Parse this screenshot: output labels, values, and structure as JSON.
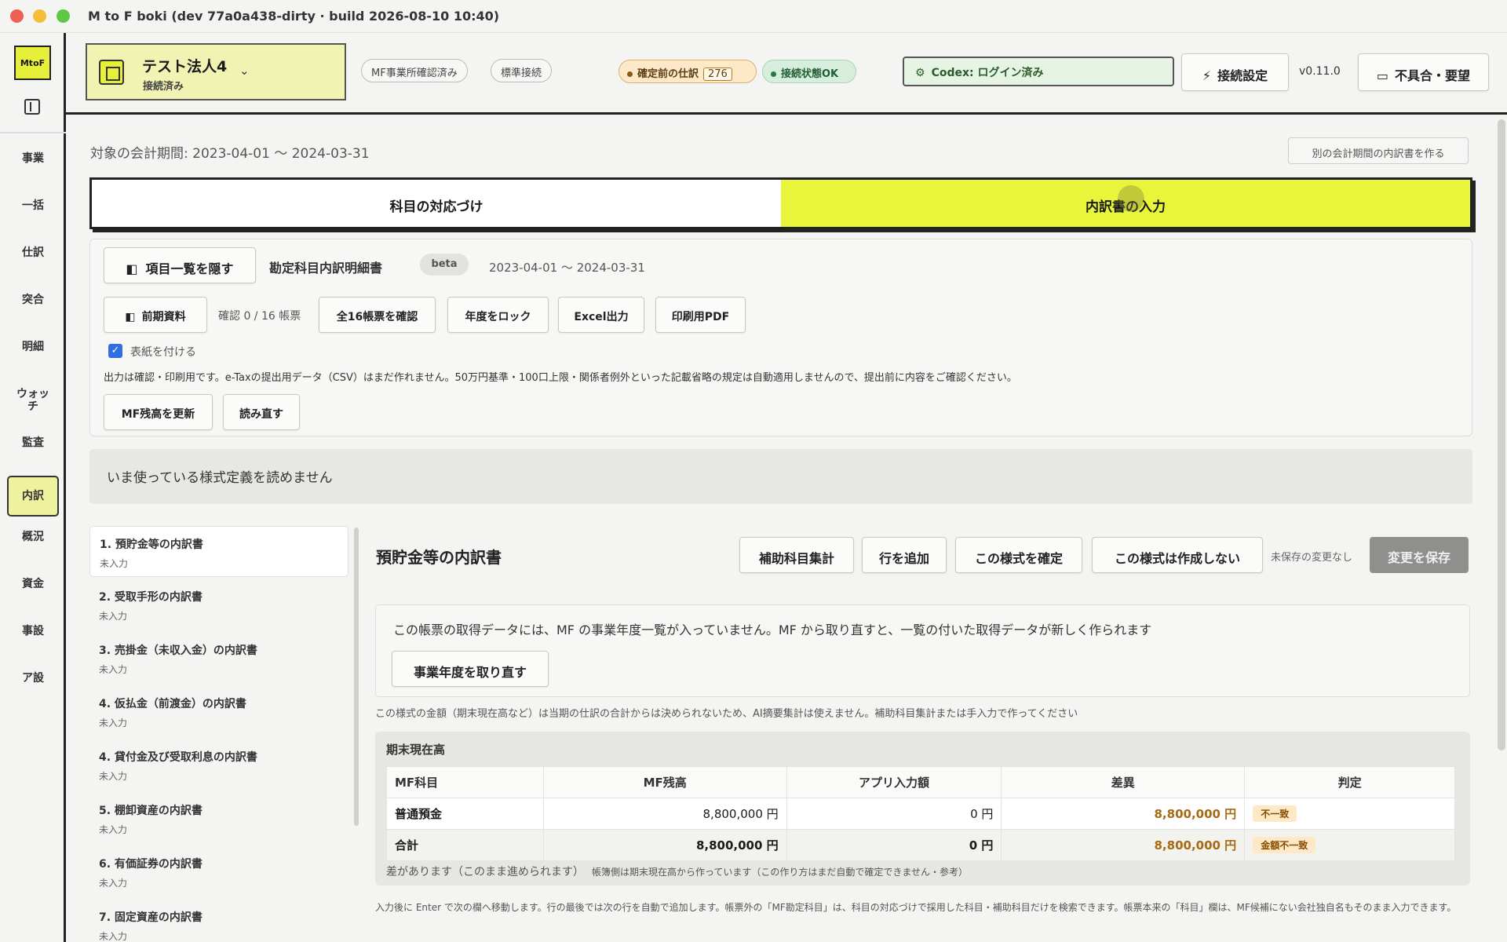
{
  "window": {
    "title": "M to F boki (dev 77a0a438-dirty · build 2026-08-10 10:40)"
  },
  "sidebar": {
    "logo": "MtoF",
    "items": [
      {
        "label": "事業"
      },
      {
        "label": "一括"
      },
      {
        "label": "仕訳"
      },
      {
        "label": "突合"
      },
      {
        "label": "明細"
      },
      {
        "label": "ウォッチ"
      },
      {
        "label": "監査"
      },
      {
        "label": "内訳"
      },
      {
        "label": "概況"
      },
      {
        "label": "資金"
      },
      {
        "label": "事設"
      },
      {
        "label": "ア設"
      }
    ],
    "active": "内訳"
  },
  "header": {
    "org_name": "テスト法人4",
    "org_status": "接続済み",
    "chip_mf_office": "MF事業所確認済み",
    "chip_standard": "標準接続",
    "draft_label": "確定前の仕訳",
    "draft_count": "276",
    "conn_status": "接続状態OK",
    "codex_status": "Codex: ログイン済み",
    "settings_button": "接続設定",
    "version": "v0.11.0",
    "feedback_button": "不具合・要望",
    "colors": {
      "accent": "#e8f53a",
      "org_bg": "#f1f3b3"
    }
  },
  "main": {
    "period_label": "対象の会計期間: 2023-04-01 〜 2024-03-31",
    "other_period_button": "別の会計期間の内訳書を作る",
    "tabs": [
      {
        "label": "科目の対応づけ"
      },
      {
        "label": "内訳書の入力"
      }
    ],
    "active_tab": "内訳書の入力",
    "toolbar": {
      "hide_list_button": "項目一覧を隠す",
      "doc_title": "勘定科目内訳明細書",
      "beta": "beta",
      "period": "2023-04-01 〜 2024-03-31",
      "prev_data_button": "前期資料",
      "confirm_count": "確認 0 / 16 帳票",
      "confirm_all_button": "全16帳票を確認",
      "lock_year_button": "年度をロック",
      "excel_button": "Excel出力",
      "pdf_button": "印刷用PDF",
      "cover_checkbox_label": "表紙を付ける",
      "cover_checked": true,
      "notice": "出力は確認・印刷用です。e-Taxの提出用データ（CSV）はまだ作れません。50万円基準・100口上限・関係者例外といった記載省略の規定は自動適用しませんので、提出前に内容をご確認ください。",
      "refresh_mf_button": "MF残高を更新",
      "reload_button": "読み直す"
    },
    "warning": "いま使っている様式定義を読めません"
  },
  "forms": [
    {
      "title": "1. 預貯金等の内訳書",
      "status": "未入力"
    },
    {
      "title": "2. 受取手形の内訳書",
      "status": "未入力"
    },
    {
      "title": "3. 売掛金（未収入金）の内訳書",
      "status": "未入力"
    },
    {
      "title": "4. 仮払金（前渡金）の内訳書",
      "status": "未入力"
    },
    {
      "title": "4. 貸付金及び受取利息の内訳書",
      "status": "未入力"
    },
    {
      "title": "5. 棚卸資産の内訳書",
      "status": "未入力"
    },
    {
      "title": "6. 有価証券の内訳書",
      "status": "未入力"
    },
    {
      "title": "7. 固定資産の内訳書",
      "status": "未入力"
    }
  ],
  "detail": {
    "title": "預貯金等の内訳書",
    "sub_account_button": "補助科目集計",
    "add_row_button": "行を追加",
    "confirm_button": "この様式を確定",
    "skip_button": "この様式は作成しない",
    "unsaved": "未保存の変更なし",
    "save_button": "変更を保存",
    "info_text": "この帳票の取得データには、MF の事業年度一覧が入っていません。MF から取り直すと、一覧の付いた取得データが新しく作られます",
    "refetch_button": "事業年度を取り直す",
    "note": "この様式の金額（期末現在高など）は当期の仕訳の合計からは決められないため、AI摘要集計は使えません。補助科目集計または手入力で作ってください",
    "balance_title": "期末現在高",
    "table_headers": [
      "MF科目",
      "MF残高",
      "アプリ入力額",
      "差異",
      "判定"
    ],
    "rows": [
      {
        "account": "普通預金",
        "mf": "8,800,000 円",
        "app": "0 円",
        "diff": "8,800,000 円",
        "judge": "不一致"
      }
    ],
    "total": {
      "account": "合計",
      "mf": "8,800,000 円",
      "app": "0 円",
      "diff": "8,800,000 円",
      "judge": "金額不一致"
    },
    "diff_note": "差があります（このまま進められます）",
    "diff_note_sub": "帳簿側は期末現在高から作っています（この作り方はまだ自動で確定できません・参考）",
    "footer": "入力後に Enter で次の欄へ移動します。行の最後では次の行を自動で追加します。帳票外の「MF勘定科目」は、科目の対応づけで採用した科目・補助科目だけを検索できます。帳票本来の「科目」欄は、MF候補にない会社独自名もそのまま入力できます。"
  }
}
